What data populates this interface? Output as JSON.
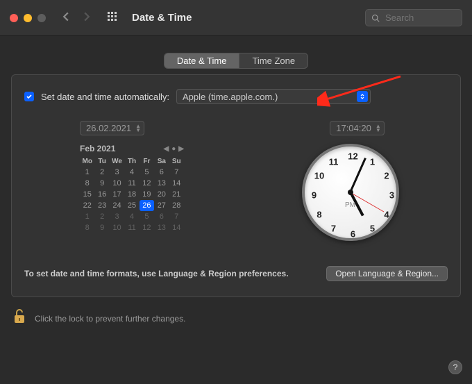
{
  "window": {
    "title": "Date & Time",
    "search_placeholder": "Search"
  },
  "tabs": {
    "date_time": "Date & Time",
    "time_zone": "Time Zone",
    "selected": "date_time"
  },
  "auto": {
    "checked": true,
    "label": "Set date and time automatically:",
    "server": "Apple (time.apple.com.)"
  },
  "date_field": "26.02.2021",
  "time_field": "17:04:20",
  "calendar": {
    "title": "Feb 2021",
    "dow": [
      "Mo",
      "Tu",
      "We",
      "Th",
      "Fr",
      "Sa",
      "Su"
    ],
    "weeks": [
      [
        "1",
        "2",
        "3",
        "4",
        "5",
        "6",
        "7"
      ],
      [
        "8",
        "9",
        "10",
        "11",
        "12",
        "13",
        "14"
      ],
      [
        "15",
        "16",
        "17",
        "18",
        "19",
        "20",
        "21"
      ],
      [
        "22",
        "23",
        "24",
        "25",
        "26",
        "27",
        "28"
      ],
      [
        "1",
        "2",
        "3",
        "4",
        "5",
        "6",
        "7"
      ],
      [
        "8",
        "9",
        "10",
        "11",
        "12",
        "13",
        "14"
      ]
    ],
    "selected_day": "26"
  },
  "clock": {
    "ampm": "PM",
    "numerals": [
      "12",
      "1",
      "2",
      "3",
      "4",
      "5",
      "6",
      "7",
      "8",
      "9",
      "10",
      "11"
    ],
    "hour_angle": 152,
    "minute_angle": 24,
    "second_angle": 120
  },
  "format_hint": "To set date and time formats, use Language & Region preferences.",
  "open_lr_button": "Open Language & Region...",
  "lock_hint": "Click the lock to prevent further changes.",
  "help_label": "?"
}
